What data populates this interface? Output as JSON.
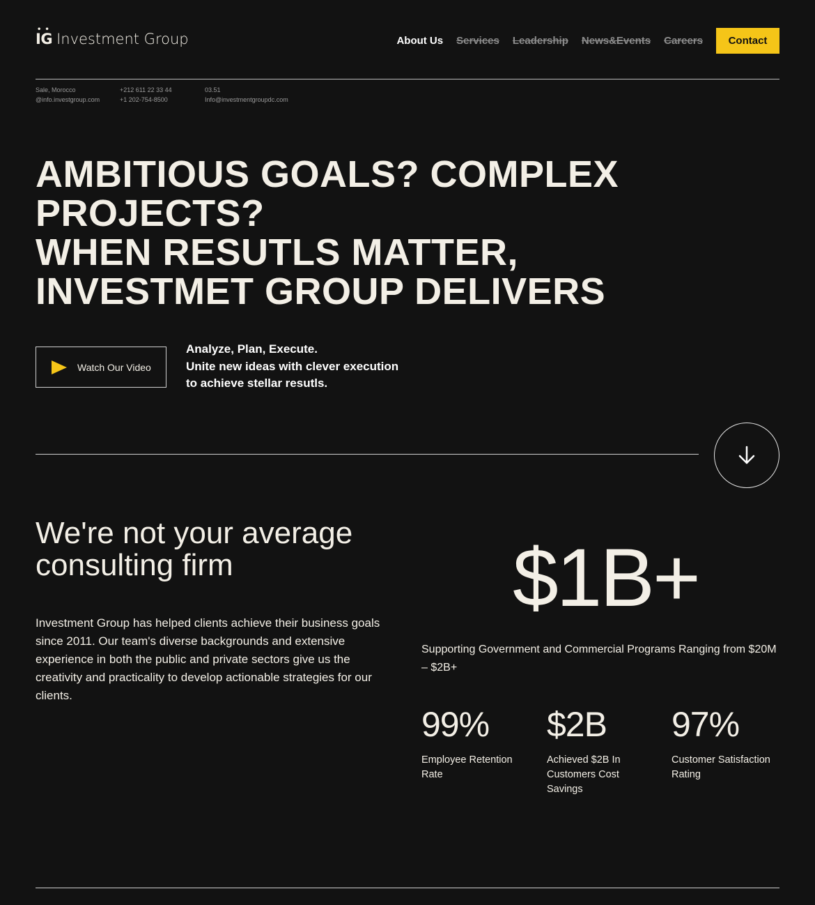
{
  "header": {
    "logo_mark": "IG",
    "logo_text": "Investment Group",
    "nav": [
      {
        "label": "About Us"
      },
      {
        "label": "Services"
      },
      {
        "label": "Leadership"
      },
      {
        "label": "News&Events"
      },
      {
        "label": "Careers"
      }
    ],
    "contact_label": "Contact"
  },
  "info": {
    "col1": [
      "Sale, Morocco",
      "@info.investgroup.com"
    ],
    "col2": [
      "+212 611 22 33 44",
      "+1 202-754-8500"
    ],
    "col3": [
      "03.51",
      "Info@investmentgroupdc.com"
    ]
  },
  "hero": {
    "lines": [
      "AMBITIOUS GOALS? COMPLEX",
      "PROJECTS?",
      "WHEN RESUTLS MATTER,",
      "INVESTMET GROUP DELIVERS"
    ],
    "video_label": "Watch Our Video",
    "tagline": [
      "Analyze, Plan, Execute.",
      "Unite new ideas with clever execution",
      "to achieve stellar resutls."
    ]
  },
  "about": {
    "title_lines": [
      "We're not your average",
      "consulting firm"
    ],
    "body": "Investment Group has helped clients achieve their business goals since 2011. Our team's diverse backgrounds and extensive experience in both the public and private sectors give us the creativity and practicality to develop actionable strategies for our clients.",
    "big_stat": "$1B+",
    "support": "Supporting Government and Commercial Programs Ranging from $20M – $2B+",
    "stats": [
      {
        "value": "99%",
        "label": "Employee Retention Rate"
      },
      {
        "value": "$2B",
        "label": "Achieved $2B In Customers Cost Savings"
      },
      {
        "value": "97%",
        "label": "Customer Satisfaction Rating"
      }
    ]
  },
  "colors": {
    "background": "#121212",
    "accent": "#f5c518",
    "text": "#f3efe6"
  }
}
